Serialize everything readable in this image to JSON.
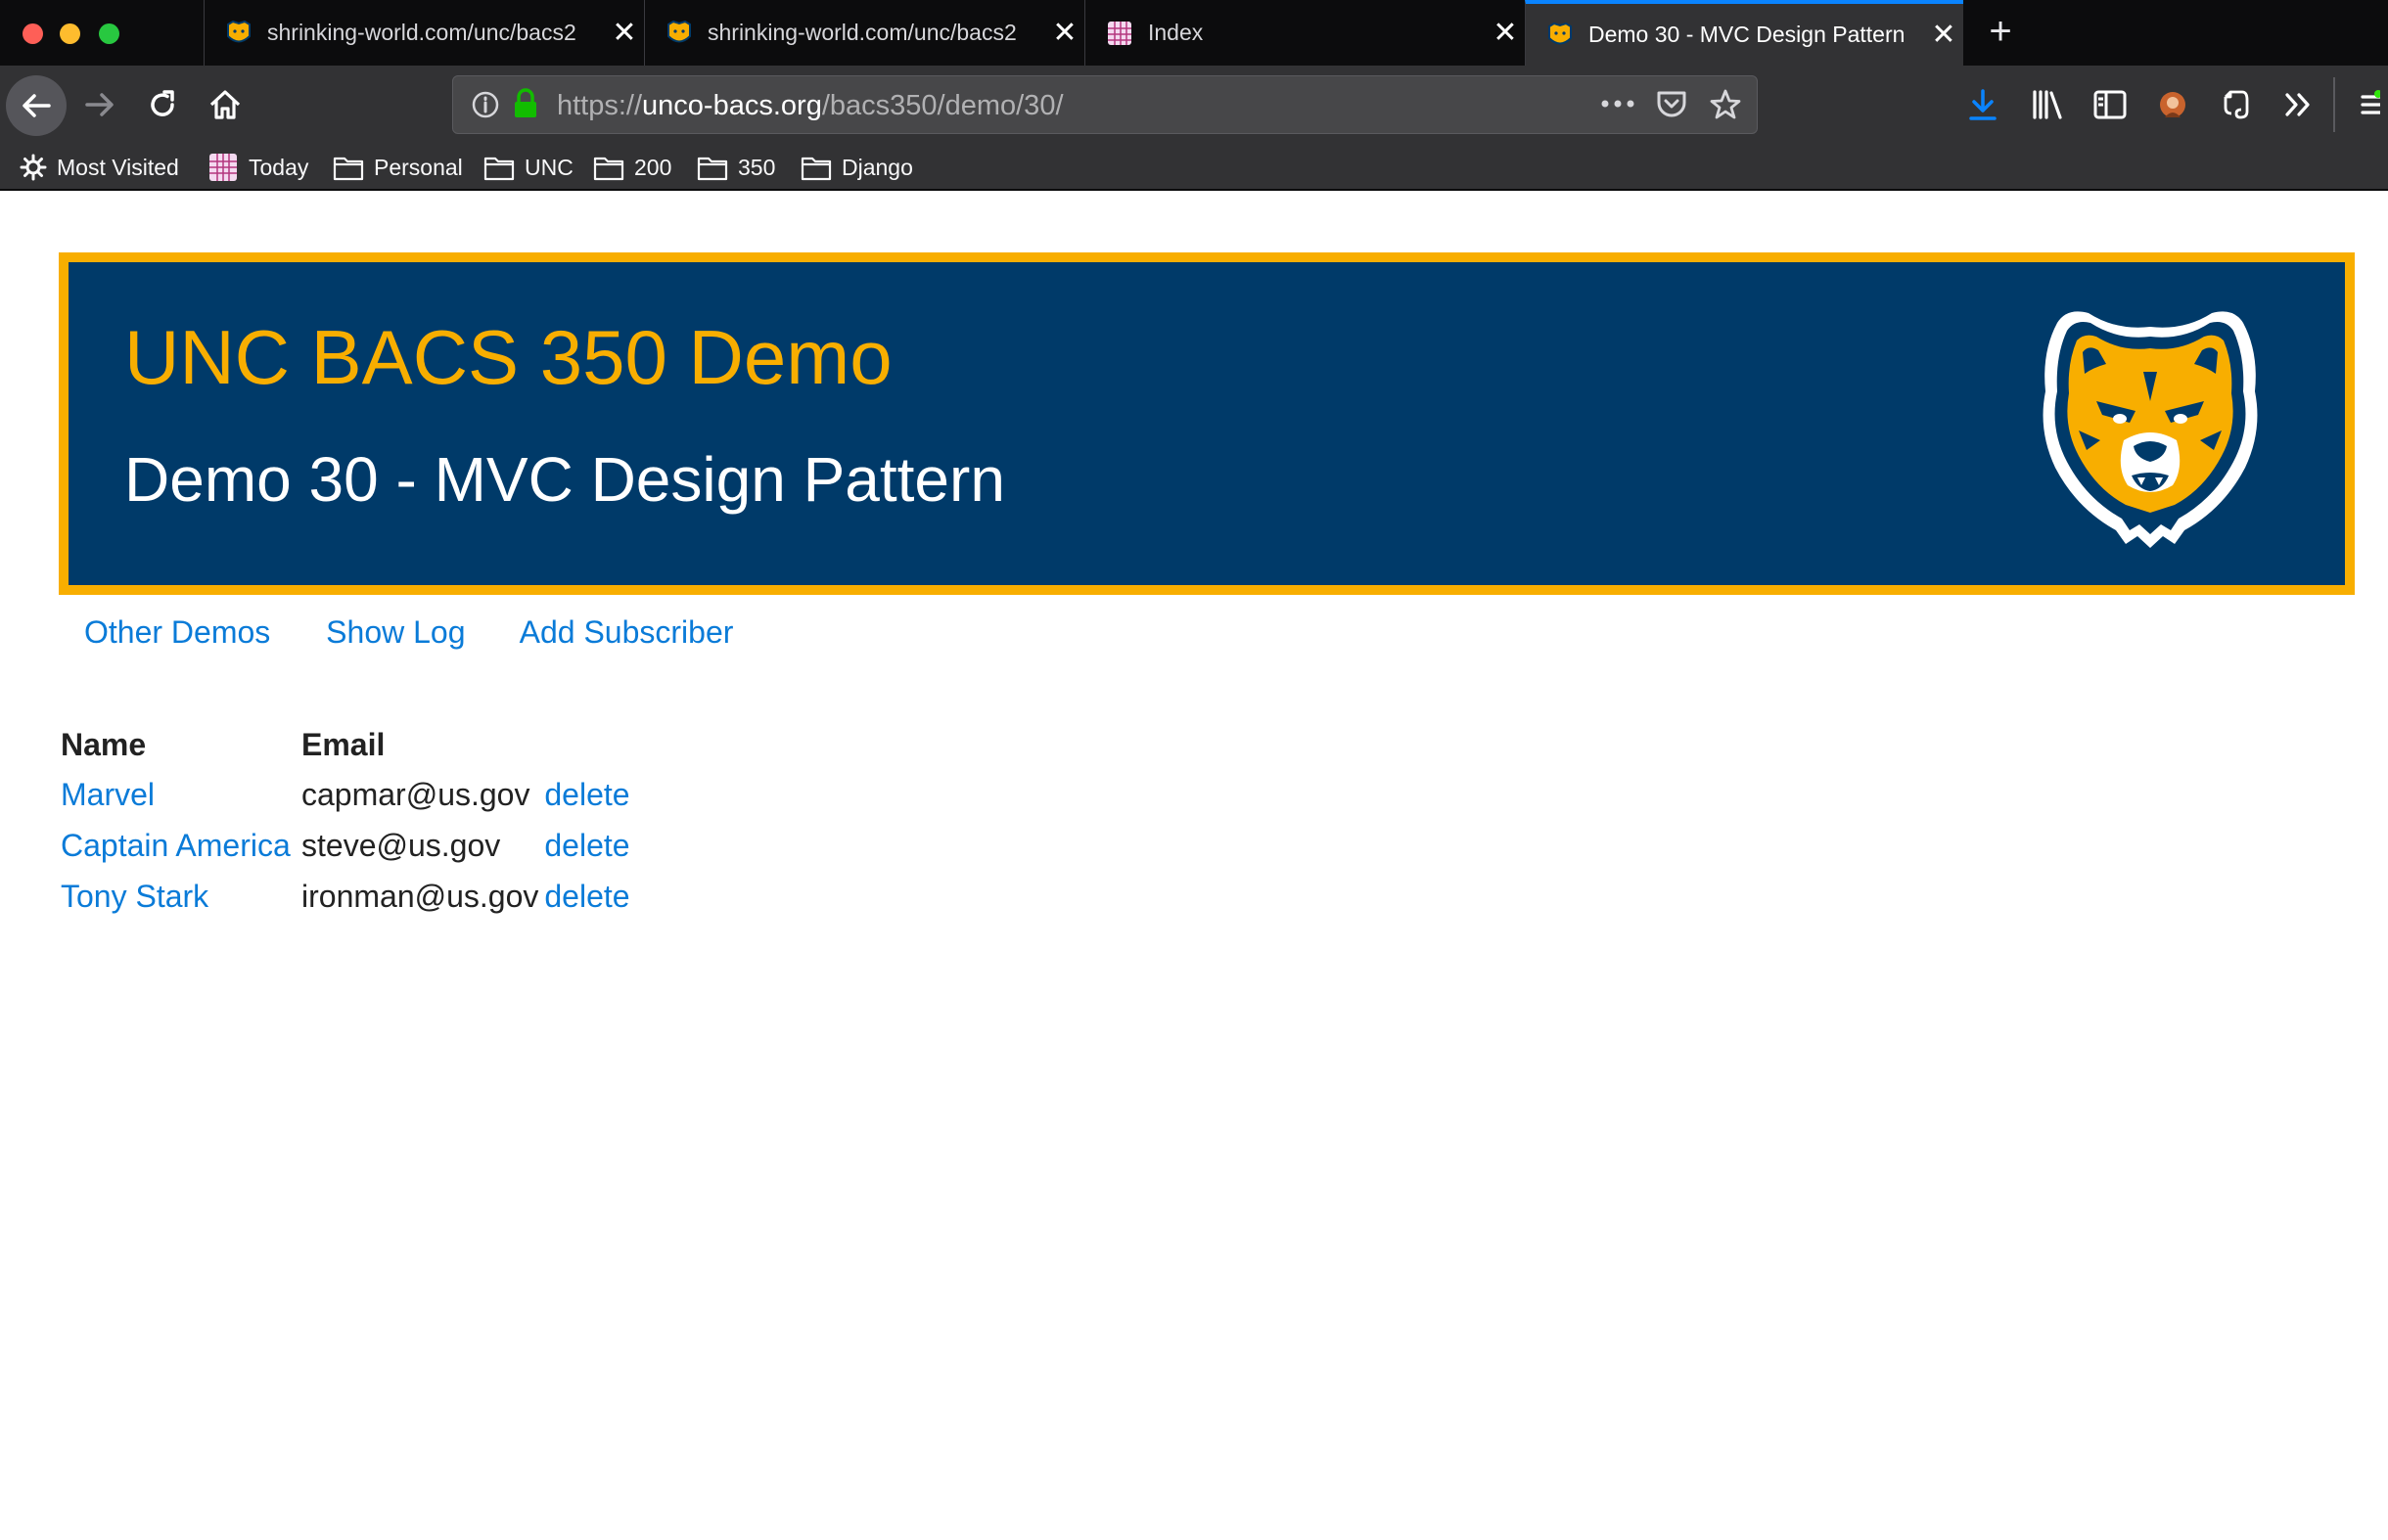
{
  "browser": {
    "tabs": [
      {
        "title": "shrinking-world.com/unc/bacs2",
        "active": false
      },
      {
        "title": "shrinking-world.com/unc/bacs2",
        "active": false
      },
      {
        "title": "Index",
        "active": false
      },
      {
        "title": "Demo 30 - MVC Design Pattern",
        "active": true
      }
    ],
    "url": {
      "scheme": "https://",
      "host": "unco-bacs.org",
      "path": "/bacs350/demo/30/"
    },
    "bookmarks": [
      "Most Visited",
      "Today",
      "Personal",
      "UNC",
      "200",
      "350",
      "Django"
    ],
    "accent_color": "#0a84ff"
  },
  "page": {
    "banner": {
      "title": "UNC BACS 350 Demo",
      "subtitle": "Demo 30 - MVC Design Pattern",
      "logo_icon": "bear-logo-icon",
      "colors": {
        "background": "#003a69",
        "border": "#f8ae00",
        "title": "#f8ae00",
        "subtitle": "#ffffff"
      }
    },
    "nav": [
      "Other Demos",
      "Show Log",
      "Add Subscriber"
    ],
    "table": {
      "headers": [
        "Name",
        "Email"
      ],
      "rows": [
        {
          "name": "Marvel",
          "email": "capmar@us.gov",
          "action": "delete"
        },
        {
          "name": "Captain America",
          "email": "steve@us.gov",
          "action": "delete"
        },
        {
          "name": "Tony Stark",
          "email": "ironman@us.gov",
          "action": "delete"
        }
      ]
    },
    "link_color": "#0a7bd8"
  }
}
